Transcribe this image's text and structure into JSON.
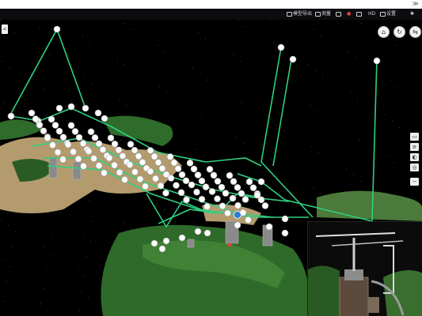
{
  "top_strip": {
    "corner_mark": "≫"
  },
  "toolbar": {
    "items": [
      {
        "label": "模型导出",
        "icon": "export-icon"
      },
      {
        "label": "测量",
        "icon": "measure-icon"
      },
      {
        "label": "",
        "icon": "camera-icon"
      },
      {
        "label": "",
        "icon": "record-icon"
      },
      {
        "label": "",
        "icon": "layers-icon"
      },
      {
        "label": "HD",
        "icon": "quality-icon"
      },
      {
        "label": "设置",
        "icon": "settings-icon"
      },
      {
        "label": "",
        "icon": "gear-icon"
      }
    ]
  },
  "viewport": {
    "left_toggle": "<",
    "top_right_buttons": [
      {
        "icon": "home-icon",
        "glyph": "⌂"
      },
      {
        "icon": "rotate-icon",
        "glyph": "↻"
      },
      {
        "icon": "split-view-icon",
        "glyph": "⇆"
      }
    ],
    "side_buttons": [
      {
        "icon": "fullscreen-icon",
        "glyph": "▭"
      },
      {
        "icon": "layer-icon",
        "glyph": "≡"
      },
      {
        "icon": "compass-icon",
        "glyph": "◐"
      },
      {
        "icon": "locate-icon",
        "glyph": "◎"
      },
      {
        "icon": "zoom-out-icon",
        "glyph": "−"
      }
    ]
  },
  "colors": {
    "route_line": "#2fd07f",
    "waypoint": "#ffffff",
    "vegetation": "#2f6b2a",
    "sand": "#b49b6e",
    "toolbar_bg": "#0c0c10",
    "accent_red": "#e0463d",
    "accent_blue": "#2f7bd8"
  }
}
